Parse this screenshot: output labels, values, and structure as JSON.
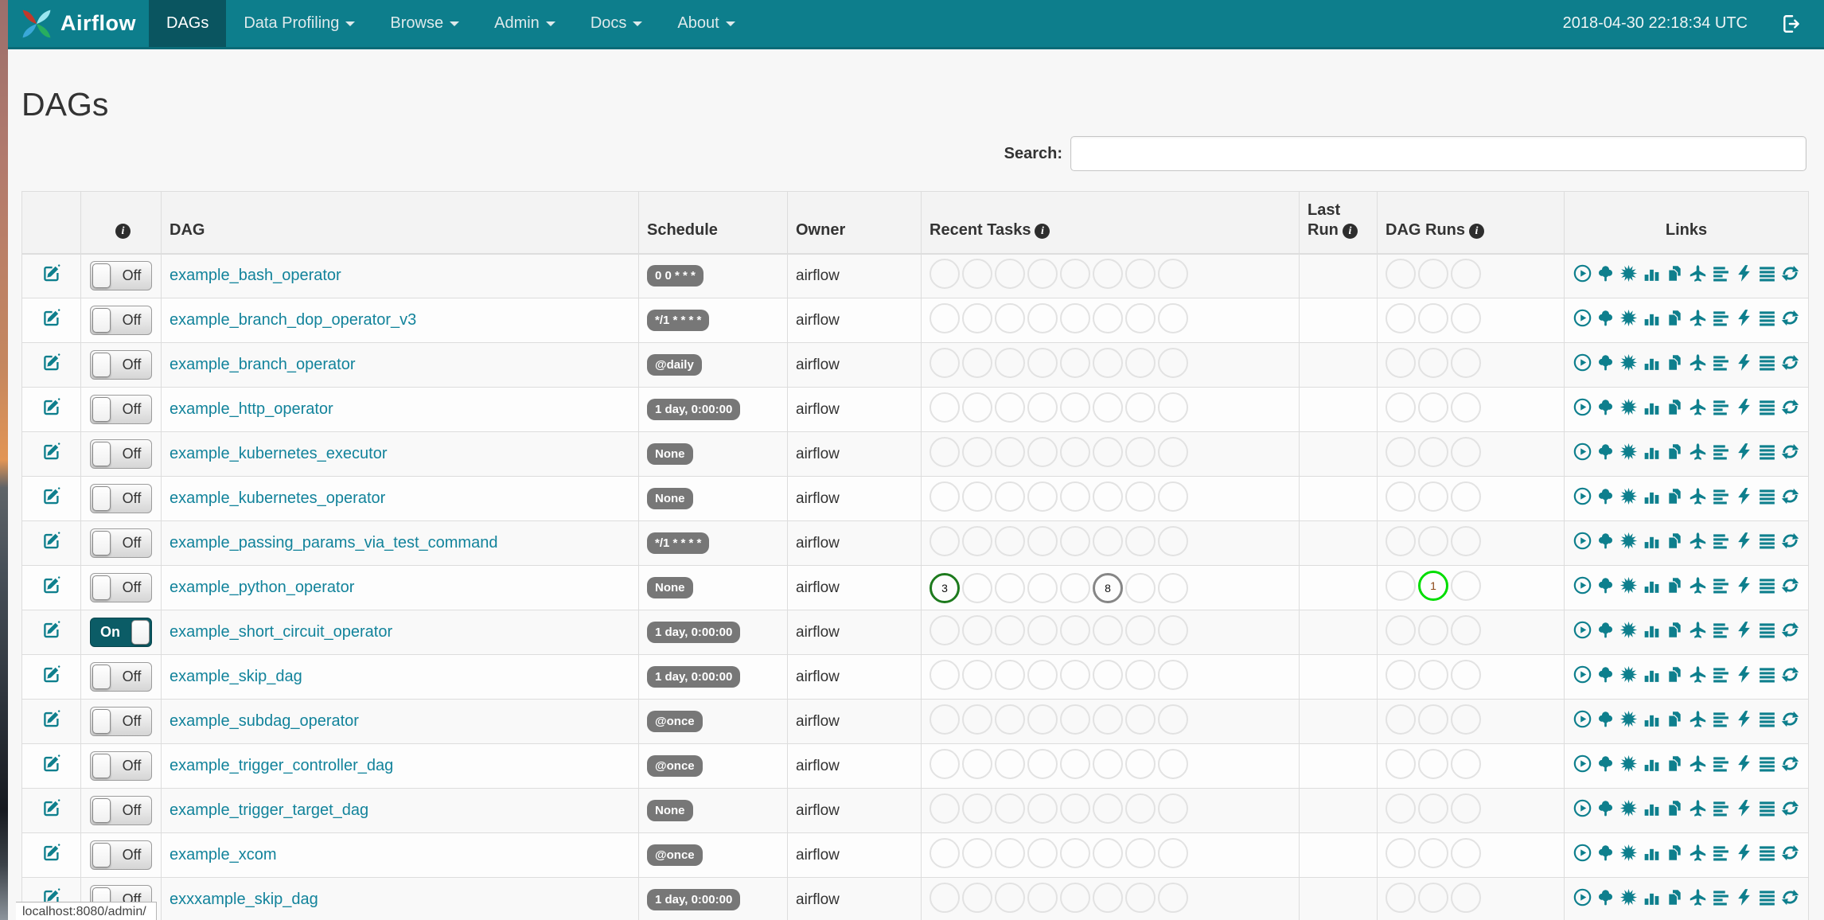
{
  "navbar": {
    "brand": "Airflow",
    "clock": "2018-04-30 22:18:34 UTC",
    "items": [
      {
        "label": "DAGs",
        "active": true,
        "caret": false
      },
      {
        "label": "Data Profiling",
        "active": false,
        "caret": true
      },
      {
        "label": "Browse",
        "active": false,
        "caret": true
      },
      {
        "label": "Admin",
        "active": false,
        "caret": true
      },
      {
        "label": "Docs",
        "active": false,
        "caret": true
      },
      {
        "label": "About",
        "active": false,
        "caret": true
      }
    ]
  },
  "page": {
    "title": "DAGs",
    "search_label": "Search:",
    "search_value": "",
    "status_bar_url": "localhost:8080/admin/"
  },
  "table": {
    "headers": [
      {
        "label": "",
        "info": false,
        "align": "left"
      },
      {
        "label": "",
        "info": true,
        "align": "center"
      },
      {
        "label": "DAG",
        "info": false,
        "align": "left"
      },
      {
        "label": "Schedule",
        "info": false,
        "align": "left"
      },
      {
        "label": "Owner",
        "info": false,
        "align": "left"
      },
      {
        "label": "Recent Tasks",
        "info": true,
        "align": "left"
      },
      {
        "label": "Last Run",
        "info": true,
        "align": "left"
      },
      {
        "label": "DAG Runs",
        "info": true,
        "align": "left"
      },
      {
        "label": "Links",
        "info": false,
        "align": "center"
      }
    ],
    "recent_task_circles": 8,
    "dag_run_circles": 3,
    "rows": [
      {
        "dag": "example_bash_operator",
        "toggle": "Off",
        "schedule": "0 0 * * *",
        "owner": "airflow",
        "last_run": "",
        "recent_tasks": [],
        "dag_runs": []
      },
      {
        "dag": "example_branch_dop_operator_v3",
        "toggle": "Off",
        "schedule": "*/1 * * * *",
        "owner": "airflow",
        "last_run": "",
        "recent_tasks": [],
        "dag_runs": []
      },
      {
        "dag": "example_branch_operator",
        "toggle": "Off",
        "schedule": "@daily",
        "owner": "airflow",
        "last_run": "",
        "recent_tasks": [],
        "dag_runs": []
      },
      {
        "dag": "example_http_operator",
        "toggle": "Off",
        "schedule": "1 day, 0:00:00",
        "owner": "airflow",
        "last_run": "",
        "recent_tasks": [],
        "dag_runs": []
      },
      {
        "dag": "example_kubernetes_executor",
        "toggle": "Off",
        "schedule": "None",
        "owner": "airflow",
        "last_run": "",
        "recent_tasks": [],
        "dag_runs": []
      },
      {
        "dag": "example_kubernetes_operator",
        "toggle": "Off",
        "schedule": "None",
        "owner": "airflow",
        "last_run": "",
        "recent_tasks": [],
        "dag_runs": []
      },
      {
        "dag": "example_passing_params_via_test_command",
        "toggle": "Off",
        "schedule": "*/1 * * * *",
        "owner": "airflow",
        "last_run": "",
        "recent_tasks": [],
        "dag_runs": []
      },
      {
        "dag": "example_python_operator",
        "toggle": "Off",
        "schedule": "None",
        "owner": "airflow",
        "last_run": "",
        "recent_tasks": [
          {
            "index": 0,
            "count": "3",
            "state": "success"
          },
          {
            "index": 5,
            "count": "8",
            "state": "queued"
          }
        ],
        "dag_runs": [
          {
            "index": 1,
            "count": "1",
            "state": "running"
          }
        ]
      },
      {
        "dag": "example_short_circuit_operator",
        "toggle": "On",
        "schedule": "1 day, 0:00:00",
        "owner": "airflow",
        "last_run": "",
        "recent_tasks": [],
        "dag_runs": []
      },
      {
        "dag": "example_skip_dag",
        "toggle": "Off",
        "schedule": "1 day, 0:00:00",
        "owner": "airflow",
        "last_run": "",
        "recent_tasks": [],
        "dag_runs": []
      },
      {
        "dag": "example_subdag_operator",
        "toggle": "Off",
        "schedule": "@once",
        "owner": "airflow",
        "last_run": "",
        "recent_tasks": [],
        "dag_runs": []
      },
      {
        "dag": "example_trigger_controller_dag",
        "toggle": "Off",
        "schedule": "@once",
        "owner": "airflow",
        "last_run": "",
        "recent_tasks": [],
        "dag_runs": []
      },
      {
        "dag": "example_trigger_target_dag",
        "toggle": "Off",
        "schedule": "None",
        "owner": "airflow",
        "last_run": "",
        "recent_tasks": [],
        "dag_runs": []
      },
      {
        "dag": "example_xcom",
        "toggle": "Off",
        "schedule": "@once",
        "owner": "airflow",
        "last_run": "",
        "recent_tasks": [],
        "dag_runs": []
      },
      {
        "dag": "exxxample_skip_dag",
        "toggle": "Off",
        "schedule": "1 day, 0:00:00",
        "owner": "airflow",
        "last_run": "",
        "recent_tasks": [],
        "dag_runs": []
      }
    ]
  },
  "links": [
    {
      "name": "trigger-dag",
      "icon": "play-circle-icon"
    },
    {
      "name": "tree-view",
      "icon": "tree-icon"
    },
    {
      "name": "graph-view",
      "icon": "sunburst-icon"
    },
    {
      "name": "task-duration",
      "icon": "bar-chart-icon"
    },
    {
      "name": "task-tries",
      "icon": "copy-icon"
    },
    {
      "name": "landing-times",
      "icon": "plane-icon"
    },
    {
      "name": "gantt-view",
      "icon": "gantt-bars-icon"
    },
    {
      "name": "code-view",
      "icon": "lightning-icon"
    },
    {
      "name": "logs",
      "icon": "justify-lines-icon"
    },
    {
      "name": "refresh",
      "icon": "refresh-icon"
    }
  ],
  "colors": {
    "navbar": "#0d7e8c",
    "navbar_active": "#0a5560",
    "link_teal": "#12839b",
    "icon_teal": "#0e7f8d",
    "badge_bg": "#777777",
    "toggle_on_bg": "#0b5c66",
    "state_success": "#1d7a1d",
    "state_running": "#00dd00",
    "state_queued": "#868686",
    "circle_empty": "#e2e2e2",
    "dag_run_count_text": "#8b4513"
  }
}
